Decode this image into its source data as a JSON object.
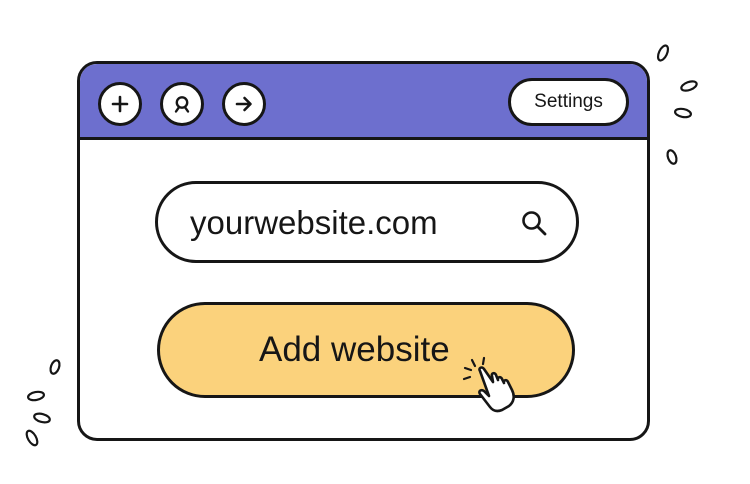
{
  "toolbar": {
    "buttons": [
      {
        "icon": "plus-icon"
      },
      {
        "icon": "profile-icon"
      },
      {
        "icon": "arrow-right-icon"
      }
    ],
    "settings_label": "Settings"
  },
  "address_bar": {
    "value": "yourwebsite.com",
    "icon": "search-icon"
  },
  "primary_action": {
    "label": "Add website",
    "icon": "hand-pointer-icon"
  },
  "colors": {
    "titlebar": "#6d6fce",
    "button_accent": "#fbd27c",
    "outline": "#161616",
    "background": "#ffffff"
  }
}
